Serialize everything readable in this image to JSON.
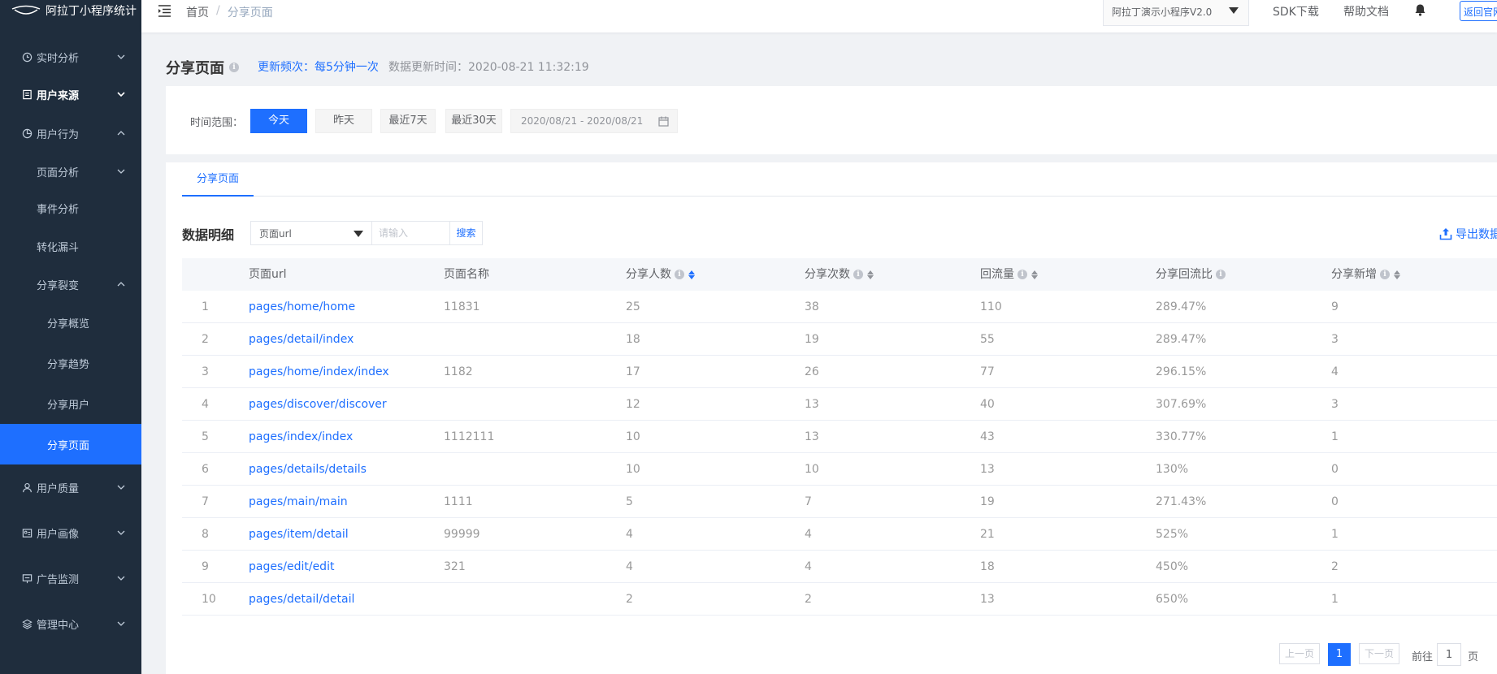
{
  "app": {
    "logo_text": "阿拉丁小程序统计"
  },
  "sidebar": {
    "items": [
      {
        "label": "实时分析"
      },
      {
        "label": "用户来源"
      },
      {
        "label": "用户行为"
      },
      {
        "label": "页面分析"
      },
      {
        "label": "事件分析"
      },
      {
        "label": "转化漏斗"
      },
      {
        "label": "分享裂变"
      },
      {
        "label": "分享概览"
      },
      {
        "label": "分享趋势"
      },
      {
        "label": "分享用户"
      },
      {
        "label": "分享页面"
      },
      {
        "label": "用户质量"
      },
      {
        "label": "用户画像"
      },
      {
        "label": "广告监测"
      },
      {
        "label": "管理中心"
      }
    ]
  },
  "header": {
    "breadcrumb": {
      "home": "首页",
      "separator": "/",
      "current": "分享页面"
    },
    "app_selector": "阿拉丁演示小程序V2.0",
    "sdk_link": "SDK下载",
    "docs_link": "帮助文档",
    "back_button": "返回官网"
  },
  "page": {
    "title": "分享页面",
    "info_icon": "i",
    "update_frequency": "更新频次：每5分钟一次",
    "update_time": "数据更新时间：2020-08-21 11:32:19"
  },
  "filter": {
    "label": "时间范围：",
    "buttons": [
      "今天",
      "昨天",
      "最近7天",
      "最近30天"
    ],
    "date_range": "2020/08/21 - 2020/08/21"
  },
  "tabs": [
    {
      "label": "分享页面"
    }
  ],
  "detail": {
    "title": "数据明细",
    "search_field": "页面url",
    "search_placeholder": "请输入",
    "search_button": "搜索",
    "export_label": "导出数据"
  },
  "table": {
    "columns": [
      "页面url",
      "页面名称",
      "分享人数",
      "分享次数",
      "回流量",
      "分享回流比",
      "分享新增"
    ],
    "rows": [
      {
        "index": "1",
        "url": "pages/home/home",
        "name": "11831",
        "sharers": "25",
        "shares": "38",
        "backflow": "110",
        "ratio": "289.47%",
        "new_users": "9"
      },
      {
        "index": "2",
        "url": "pages/detail/index",
        "name": "",
        "sharers": "18",
        "shares": "19",
        "backflow": "55",
        "ratio": "289.47%",
        "new_users": "3"
      },
      {
        "index": "3",
        "url": "pages/home/index/index",
        "name": "1182",
        "sharers": "17",
        "shares": "26",
        "backflow": "77",
        "ratio": "296.15%",
        "new_users": "4"
      },
      {
        "index": "4",
        "url": "pages/discover/discover",
        "name": "",
        "sharers": "12",
        "shares": "13",
        "backflow": "40",
        "ratio": "307.69%",
        "new_users": "3"
      },
      {
        "index": "5",
        "url": "pages/index/index",
        "name": "1112111",
        "sharers": "10",
        "shares": "13",
        "backflow": "43",
        "ratio": "330.77%",
        "new_users": "1"
      },
      {
        "index": "6",
        "url": "pages/details/details",
        "name": "",
        "sharers": "10",
        "shares": "10",
        "backflow": "13",
        "ratio": "130%",
        "new_users": "0"
      },
      {
        "index": "7",
        "url": "pages/main/main",
        "name": "1111",
        "sharers": "5",
        "shares": "7",
        "backflow": "19",
        "ratio": "271.43%",
        "new_users": "0"
      },
      {
        "index": "8",
        "url": "pages/item/detail",
        "name": "99999",
        "sharers": "4",
        "shares": "4",
        "backflow": "21",
        "ratio": "525%",
        "new_users": "1"
      },
      {
        "index": "9",
        "url": "pages/edit/edit",
        "name": "321",
        "sharers": "4",
        "shares": "4",
        "backflow": "18",
        "ratio": "450%",
        "new_users": "2"
      },
      {
        "index": "10",
        "url": "pages/detail/detail",
        "name": "",
        "sharers": "2",
        "shares": "2",
        "backflow": "13",
        "ratio": "650%",
        "new_users": "1"
      }
    ]
  },
  "pagination": {
    "prev": "上一页",
    "current_page": "1",
    "next": "下一页",
    "goto_prefix": "前往",
    "goto_value": "1",
    "goto_suffix": "页"
  },
  "colors": {
    "accent": "#1e6fff",
    "sidebar_bg": "#1f2d3d"
  }
}
